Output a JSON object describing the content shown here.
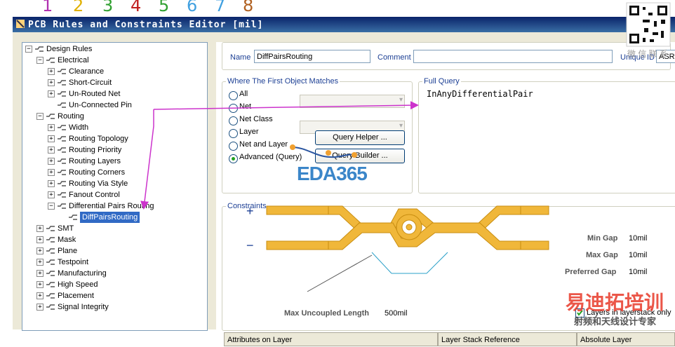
{
  "digits": [
    "1",
    "2",
    "3",
    "4",
    "5",
    "6",
    "7",
    "8"
  ],
  "window": {
    "title": "PCB Rules and Constraints Editor [mil]"
  },
  "tree": [
    {
      "label": "Design Rules",
      "level": 0,
      "exp": "−",
      "icon": "design-rules-icon"
    },
    {
      "label": "Electrical",
      "level": 1,
      "exp": "−",
      "icon": "electrical-icon"
    },
    {
      "label": "Clearance",
      "level": 2,
      "exp": "+",
      "icon": "rule-icon"
    },
    {
      "label": "Short-Circuit",
      "level": 2,
      "exp": "+",
      "icon": "rule-icon"
    },
    {
      "label": "Un-Routed Net",
      "level": 2,
      "exp": "+",
      "icon": "rule-icon"
    },
    {
      "label": "Un-Connected Pin",
      "level": 2,
      "exp": "",
      "icon": "rule-icon"
    },
    {
      "label": "Routing",
      "level": 1,
      "exp": "−",
      "icon": "routing-icon"
    },
    {
      "label": "Width",
      "level": 2,
      "exp": "+",
      "icon": "routing-rule-icon"
    },
    {
      "label": "Routing Topology",
      "level": 2,
      "exp": "+",
      "icon": "routing-rule-icon"
    },
    {
      "label": "Routing Priority",
      "level": 2,
      "exp": "+",
      "icon": "routing-rule-icon"
    },
    {
      "label": "Routing Layers",
      "level": 2,
      "exp": "+",
      "icon": "routing-rule-icon"
    },
    {
      "label": "Routing Corners",
      "level": 2,
      "exp": "+",
      "icon": "routing-rule-icon"
    },
    {
      "label": "Routing Via Style",
      "level": 2,
      "exp": "+",
      "icon": "routing-rule-icon"
    },
    {
      "label": "Fanout Control",
      "level": 2,
      "exp": "+",
      "icon": "routing-rule-icon"
    },
    {
      "label": "Differential Pairs Routing",
      "level": 2,
      "exp": "−",
      "icon": "routing-rule-icon"
    },
    {
      "label": "DiffPairsRouting",
      "level": 3,
      "exp": "",
      "icon": "routing-rule-icon",
      "selected": true
    },
    {
      "label": "SMT",
      "level": 1,
      "exp": "+",
      "icon": "smt-icon"
    },
    {
      "label": "Mask",
      "level": 1,
      "exp": "+",
      "icon": "mask-icon"
    },
    {
      "label": "Plane",
      "level": 1,
      "exp": "+",
      "icon": "plane-icon"
    },
    {
      "label": "Testpoint",
      "level": 1,
      "exp": "+",
      "icon": "testpoint-icon"
    },
    {
      "label": "Manufacturing",
      "level": 1,
      "exp": "+",
      "icon": "manufacturing-icon"
    },
    {
      "label": "High Speed",
      "level": 1,
      "exp": "+",
      "icon": "high-speed-icon"
    },
    {
      "label": "Placement",
      "level": 1,
      "exp": "+",
      "icon": "placement-icon"
    },
    {
      "label": "Signal Integrity",
      "level": 1,
      "exp": "+",
      "icon": "signal-integrity-icon"
    }
  ],
  "form": {
    "name_label": "Name",
    "name_value": "DiffPairsRouting",
    "comment_label": "Comment",
    "comment_value": "",
    "uid_label": "Unique ID",
    "uid_value": "ASRHBX"
  },
  "match": {
    "title": "Where The First Object Matches",
    "options": [
      "All",
      "Net",
      "Net Class",
      "Layer",
      "Net and Layer",
      "Advanced (Query)"
    ],
    "selected": "Advanced (Query)",
    "query_helper": "Query Helper ...",
    "query_builder": "Query Builder ..."
  },
  "full_query": {
    "title": "Full Query",
    "text": "InAnyDifferentialPair"
  },
  "constraints": {
    "title": "Constraints",
    "plus": "+",
    "minus": "−",
    "min_gap_label": "Min Gap",
    "min_gap": "10mil",
    "max_gap_label": "Max Gap",
    "max_gap": "10mil",
    "pref_gap_label": "Preferred Gap",
    "pref_gap": "10mil",
    "max_uncoupled_label": "Max Uncoupled Length",
    "max_uncoupled": "500mil",
    "layers_checkbox": "Layers in layerstack only"
  },
  "table": {
    "headers": [
      "Attributes on Layer",
      "Layer Stack Reference",
      "Absolute Layer"
    ]
  },
  "watermarks": {
    "eda": "EDA365",
    "cn_top": "微 信 联 系",
    "cn_big": "易迪拓培训",
    "cn_small": "射频和天线设计专家"
  },
  "colors": {
    "trace": "#f0b73a",
    "arrow": "#cc33cc",
    "eda_blue": "#3b86c9",
    "red_wm": "#e83a2a"
  }
}
